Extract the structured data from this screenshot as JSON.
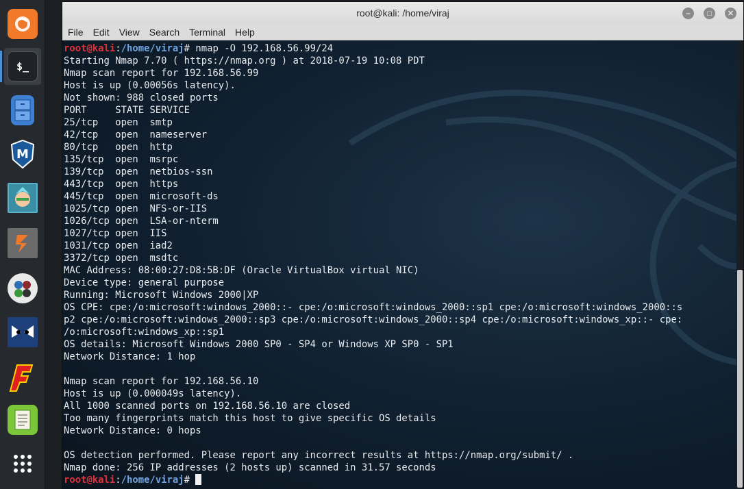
{
  "window": {
    "title": "root@kali: /home/viraj"
  },
  "menu": [
    "File",
    "Edit",
    "View",
    "Search",
    "Terminal",
    "Help"
  ],
  "dock": {
    "items": [
      {
        "name": "firefox-icon"
      },
      {
        "name": "terminal-icon",
        "label": "$_"
      },
      {
        "name": "file-manager-icon"
      },
      {
        "name": "metasploit-icon",
        "label": "M"
      },
      {
        "name": "armitage-icon"
      },
      {
        "name": "burpsuite-icon"
      },
      {
        "name": "maltego-icon"
      },
      {
        "name": "beef-icon"
      },
      {
        "name": "faraday-icon",
        "label": "F"
      },
      {
        "name": "leafpad-icon"
      },
      {
        "name": "show-apps-icon"
      }
    ]
  },
  "terminal": {
    "prompt_user": "root@kali",
    "prompt_sep": ":",
    "prompt_path": "/home/viraj",
    "prompt_end": "# ",
    "command": "nmap -O 192.168.56.99/24",
    "output": [
      "Starting Nmap 7.70 ( https://nmap.org ) at 2018-07-19 10:08 PDT",
      "Nmap scan report for 192.168.56.99",
      "Host is up (0.00056s latency).",
      "Not shown: 988 closed ports",
      "PORT     STATE SERVICE",
      "25/tcp   open  smtp",
      "42/tcp   open  nameserver",
      "80/tcp   open  http",
      "135/tcp  open  msrpc",
      "139/tcp  open  netbios-ssn",
      "443/tcp  open  https",
      "445/tcp  open  microsoft-ds",
      "1025/tcp open  NFS-or-IIS",
      "1026/tcp open  LSA-or-nterm",
      "1027/tcp open  IIS",
      "1031/tcp open  iad2",
      "3372/tcp open  msdtc",
      "MAC Address: 08:00:27:D8:5B:DF (Oracle VirtualBox virtual NIC)",
      "Device type: general purpose",
      "Running: Microsoft Windows 2000|XP",
      "OS CPE: cpe:/o:microsoft:windows_2000::- cpe:/o:microsoft:windows_2000::sp1 cpe:/o:microsoft:windows_2000::s",
      "p2 cpe:/o:microsoft:windows_2000::sp3 cpe:/o:microsoft:windows_2000::sp4 cpe:/o:microsoft:windows_xp::- cpe:",
      "/o:microsoft:windows_xp::sp1",
      "OS details: Microsoft Windows 2000 SP0 - SP4 or Windows XP SP0 - SP1",
      "Network Distance: 1 hop",
      "",
      "Nmap scan report for 192.168.56.10",
      "Host is up (0.000049s latency).",
      "All 1000 scanned ports on 192.168.56.10 are closed",
      "Too many fingerprints match this host to give specific OS details",
      "Network Distance: 0 hops",
      "",
      "OS detection performed. Please report any incorrect results at https://nmap.org/submit/ .",
      "Nmap done: 256 IP addresses (2 hosts up) scanned in 31.57 seconds"
    ]
  }
}
